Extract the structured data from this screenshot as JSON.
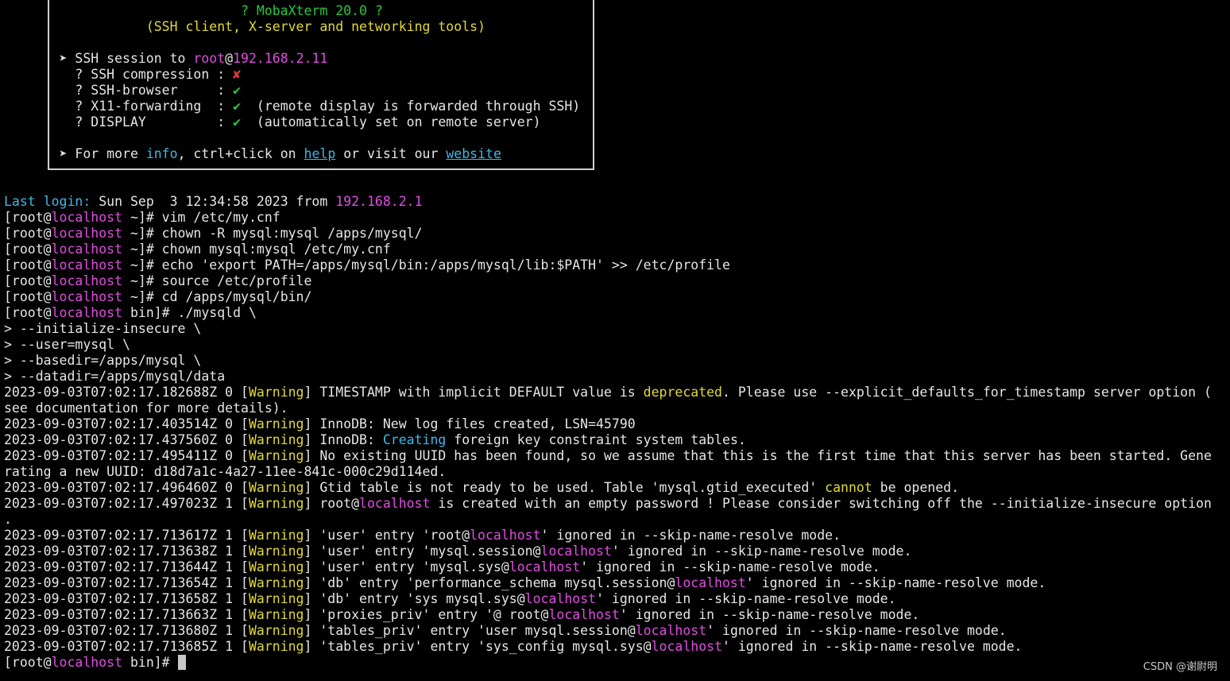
{
  "colors": {
    "background": "#000000",
    "default": "#e6e6e6",
    "cyan": "#3fb8e6",
    "magenta": "#e24ce3",
    "yellow": "#e2d936",
    "green": "#27c83a",
    "red": "#ef3b3b"
  },
  "watermark": "CSDN @谢尉明",
  "lines": [
    [
      [
        "def",
        "                              "
      ],
      [
        "grn",
        "? MobaXterm 20.0 ?"
      ]
    ],
    [
      [
        "def",
        "                  "
      ],
      [
        "yel",
        "(SSH client, X-server and networking tools)"
      ]
    ],
    [],
    [
      [
        "def",
        "       ➤ SSH session to "
      ],
      [
        "mag",
        "root"
      ],
      [
        "def",
        "@"
      ],
      [
        "mag",
        "192.168.2.11"
      ]
    ],
    [
      [
        "def",
        "         ? SSH compression : "
      ],
      [
        "red",
        "✘"
      ]
    ],
    [
      [
        "def",
        "         ? SSH-browser     : "
      ],
      [
        "grn",
        "✔"
      ]
    ],
    [
      [
        "def",
        "         ? X11-forwarding  : "
      ],
      [
        "grn",
        "✔"
      ],
      [
        "def",
        "  (remote display is forwarded through SSH)"
      ]
    ],
    [
      [
        "def",
        "         ? DISPLAY         : "
      ],
      [
        "grn",
        "✔"
      ],
      [
        "def",
        "  (automatically set on remote server)"
      ]
    ],
    [],
    [
      [
        "def",
        "       ➤ For more "
      ],
      [
        "cyan",
        "info"
      ],
      [
        "def",
        ", ctrl+click on "
      ],
      [
        "cyan-ul",
        "help"
      ],
      [
        "def",
        " or visit our "
      ],
      [
        "cyan-ul",
        "website"
      ]
    ],
    [],
    [],
    [
      [
        "cyan",
        "Last login:"
      ],
      [
        "def",
        " Sun Sep  3 12:34:58 2023 from "
      ],
      [
        "mag",
        "192.168.2.1"
      ]
    ],
    [
      [
        "def",
        "[root@"
      ],
      [
        "mag",
        "localhost"
      ],
      [
        "def",
        " ~]# vim /etc/my.cnf"
      ]
    ],
    [
      [
        "def",
        "[root@"
      ],
      [
        "mag",
        "localhost"
      ],
      [
        "def",
        " ~]# chown -R mysql:mysql /apps/mysql/"
      ]
    ],
    [
      [
        "def",
        "[root@"
      ],
      [
        "mag",
        "localhost"
      ],
      [
        "def",
        " ~]# chown mysql:mysql /etc/my.cnf"
      ]
    ],
    [
      [
        "def",
        "[root@"
      ],
      [
        "mag",
        "localhost"
      ],
      [
        "def",
        " ~]# echo 'export PATH=/apps/mysql/bin:/apps/mysql/lib:$PATH' >> /etc/profile"
      ]
    ],
    [
      [
        "def",
        "[root@"
      ],
      [
        "mag",
        "localhost"
      ],
      [
        "def",
        " ~]# source /etc/profile"
      ]
    ],
    [
      [
        "def",
        "[root@"
      ],
      [
        "mag",
        "localhost"
      ],
      [
        "def",
        " ~]# cd /apps/mysql/bin/"
      ]
    ],
    [
      [
        "def",
        "[root@"
      ],
      [
        "mag",
        "localhost"
      ],
      [
        "def",
        " bin]# ./mysqld \\"
      ]
    ],
    [
      [
        "def",
        "> --initialize-insecure \\"
      ]
    ],
    [
      [
        "def",
        "> --user=mysql \\"
      ]
    ],
    [
      [
        "def",
        "> --basedir=/apps/mysql \\"
      ]
    ],
    [
      [
        "def",
        "> --datadir=/apps/mysql/data"
      ]
    ],
    [
      [
        "def",
        "2023-09-03T07:02:17.182688Z 0 ["
      ],
      [
        "yel",
        "Warning"
      ],
      [
        "def",
        "] TIMESTAMP with implicit DEFAULT value is "
      ],
      [
        "yel",
        "deprecated"
      ],
      [
        "def",
        ". Please use --explicit_defaults_for_timestamp server option ("
      ]
    ],
    [
      [
        "def",
        "see documentation for more details)."
      ]
    ],
    [
      [
        "def",
        "2023-09-03T07:02:17.403514Z 0 ["
      ],
      [
        "yel",
        "Warning"
      ],
      [
        "def",
        "] InnoDB: New log files created, LSN=45790"
      ]
    ],
    [
      [
        "def",
        "2023-09-03T07:02:17.437560Z 0 ["
      ],
      [
        "yel",
        "Warning"
      ],
      [
        "def",
        "] InnoDB: "
      ],
      [
        "cyan",
        "Creating"
      ],
      [
        "def",
        " foreign key constraint system tables."
      ]
    ],
    [
      [
        "def",
        "2023-09-03T07:02:17.495411Z 0 ["
      ],
      [
        "yel",
        "Warning"
      ],
      [
        "def",
        "] No existing UUID has been found, so we assume that this is the first time that this server has been started. Gene"
      ]
    ],
    [
      [
        "def",
        "rating a new UUID: d18d7a1c-4a27-11ee-841c-000c29d114ed."
      ]
    ],
    [
      [
        "def",
        "2023-09-03T07:02:17.496460Z 0 ["
      ],
      [
        "yel",
        "Warning"
      ],
      [
        "def",
        "] Gtid table is not ready to be used. Table 'mysql.gtid_executed' "
      ],
      [
        "yel",
        "cannot"
      ],
      [
        "def",
        " be opened."
      ]
    ],
    [
      [
        "def",
        "2023-09-03T07:02:17.497023Z 1 ["
      ],
      [
        "yel",
        "Warning"
      ],
      [
        "def",
        "] root@"
      ],
      [
        "mag",
        "localhost"
      ],
      [
        "def",
        " is created with an empty password ! Please consider switching off the --initialize-insecure option"
      ]
    ],
    [
      [
        "def",
        "."
      ]
    ],
    [
      [
        "def",
        "2023-09-03T07:02:17.713617Z 1 ["
      ],
      [
        "yel",
        "Warning"
      ],
      [
        "def",
        "] 'user' entry 'root@"
      ],
      [
        "mag",
        "localhost"
      ],
      [
        "def",
        "' ignored in --skip-name-resolve mode."
      ]
    ],
    [
      [
        "def",
        "2023-09-03T07:02:17.713638Z 1 ["
      ],
      [
        "yel",
        "Warning"
      ],
      [
        "def",
        "] 'user' entry 'mysql.session@"
      ],
      [
        "mag",
        "localhost"
      ],
      [
        "def",
        "' ignored in --skip-name-resolve mode."
      ]
    ],
    [
      [
        "def",
        "2023-09-03T07:02:17.713644Z 1 ["
      ],
      [
        "yel",
        "Warning"
      ],
      [
        "def",
        "] 'user' entry 'mysql.sys@"
      ],
      [
        "mag",
        "localhost"
      ],
      [
        "def",
        "' ignored in --skip-name-resolve mode."
      ]
    ],
    [
      [
        "def",
        "2023-09-03T07:02:17.713654Z 1 ["
      ],
      [
        "yel",
        "Warning"
      ],
      [
        "def",
        "] 'db' entry 'performance_schema mysql.session@"
      ],
      [
        "mag",
        "localhost"
      ],
      [
        "def",
        "' ignored in --skip-name-resolve mode."
      ]
    ],
    [
      [
        "def",
        "2023-09-03T07:02:17.713658Z 1 ["
      ],
      [
        "yel",
        "Warning"
      ],
      [
        "def",
        "] 'db' entry 'sys mysql.sys@"
      ],
      [
        "mag",
        "localhost"
      ],
      [
        "def",
        "' ignored in --skip-name-resolve mode."
      ]
    ],
    [
      [
        "def",
        "2023-09-03T07:02:17.713663Z 1 ["
      ],
      [
        "yel",
        "Warning"
      ],
      [
        "def",
        "] 'proxies_priv' entry '@ root@"
      ],
      [
        "mag",
        "localhost"
      ],
      [
        "def",
        "' ignored in --skip-name-resolve mode."
      ]
    ],
    [
      [
        "def",
        "2023-09-03T07:02:17.713680Z 1 ["
      ],
      [
        "yel",
        "Warning"
      ],
      [
        "def",
        "] 'tables_priv' entry 'user mysql.session@"
      ],
      [
        "mag",
        "localhost"
      ],
      [
        "def",
        "' ignored in --skip-name-resolve mode."
      ]
    ],
    [
      [
        "def",
        "2023-09-03T07:02:17.713685Z 1 ["
      ],
      [
        "yel",
        "Warning"
      ],
      [
        "def",
        "] 'tables_priv' entry 'sys_config mysql.sys@"
      ],
      [
        "mag",
        "localhost"
      ],
      [
        "def",
        "' ignored in --skip-name-resolve mode."
      ]
    ],
    [
      [
        "def",
        "[root@"
      ],
      [
        "mag",
        "localhost"
      ],
      [
        "def",
        " bin]# "
      ]
    ]
  ],
  "prompt_line_index": 41
}
